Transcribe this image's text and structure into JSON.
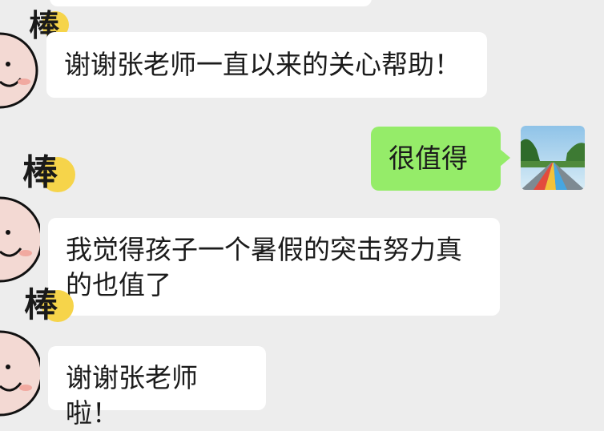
{
  "chat": {
    "messages": [
      {
        "side": "left",
        "text": "谢谢张老师一直以来的关心帮助！"
      },
      {
        "side": "right",
        "text": "很值得"
      },
      {
        "side": "left",
        "text": "我觉得孩子一个暑假的突击努力真的也值了",
        "lines": [
          "我觉得孩子一个暑假的突击努力真",
          "的也值了"
        ]
      },
      {
        "side": "left",
        "text": "谢谢张老师啦！"
      }
    ],
    "sticker_text": "棒"
  },
  "colors": {
    "background": "#ededed",
    "bubble_left": "#ffffff",
    "bubble_right": "#95ec69"
  }
}
